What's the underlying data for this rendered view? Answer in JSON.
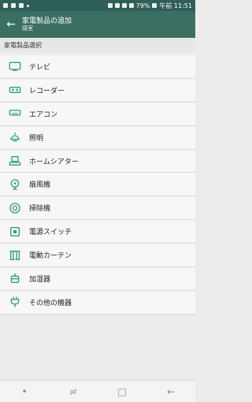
{
  "status": {
    "battery": "79%",
    "time": "午前 11:51"
  },
  "header": {
    "title": "家電製品の追加",
    "subtitle": "寝室"
  },
  "section": {
    "title": "家電製品選択"
  },
  "items": [
    {
      "label": "テレビ",
      "icon": "tv-icon"
    },
    {
      "label": "レコーダー",
      "icon": "recorder-icon"
    },
    {
      "label": "エアコン",
      "icon": "air-conditioner-icon"
    },
    {
      "label": "照明",
      "icon": "light-icon"
    },
    {
      "label": "ホームシアター",
      "icon": "home-theater-icon"
    },
    {
      "label": "扇風機",
      "icon": "fan-icon"
    },
    {
      "label": "掃除機",
      "icon": "vacuum-icon"
    },
    {
      "label": "電源スイッチ",
      "icon": "power-switch-icon"
    },
    {
      "label": "電動カーテン",
      "icon": "curtain-icon"
    },
    {
      "label": "加湿器",
      "icon": "humidifier-icon"
    },
    {
      "label": "その他の機器",
      "icon": "plug-icon"
    }
  ],
  "colors": {
    "accent": "#2e9d84",
    "header": "#3c6f63",
    "status": "#2f5f57"
  }
}
